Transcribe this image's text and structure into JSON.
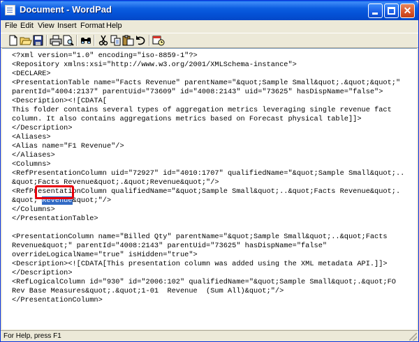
{
  "window": {
    "title": "Document - WordPad"
  },
  "menu": {
    "items": [
      "File",
      "Edit",
      "View",
      "Insert",
      "Format",
      "Help"
    ]
  },
  "toolbar": {
    "icons": [
      "new-icon",
      "open-icon",
      "save-icon",
      "print-icon",
      "print-preview-icon",
      "find-icon",
      "cut-icon",
      "copy-icon",
      "paste-icon",
      "undo-icon",
      "date-time-icon"
    ]
  },
  "document": {
    "lines": [
      "<?xml version=\"1.0\" encoding=\"iso-8859-1\"?>",
      "<Repository xmlns:xsi=\"http://www.w3.org/2001/XMLSchema-instance\">",
      "<DECLARE>",
      "<PresentationTable name=\"Facts Revenue\" parentName=\"&quot;Sample Small&quot;.&quot;&quot;\"",
      "parentId=\"4004:2137\" parentUid=\"73609\" id=\"4008:2143\" uid=\"73625\" hasDispName=\"false\">",
      "<Description><![CDATA[",
      "This folder contains several types of aggregation metrics leveraging single revenue fact",
      "column. It also contains aggregations metrics based on Forecast physical table]]>",
      "</Description>",
      "<Aliases>",
      "<Alias name=\"F1 Revenue\"/>",
      "</Aliases>",
      "<Columns>",
      "<RefPresentationColumn uid=\"72927\" id=\"4010:1707\" qualifiedName=\"&quot;Sample Small&quot;..",
      "&quot;Facts Revenue&quot;.&quot;Revenue&quot;\"/>",
      "<RefPresentationColumn qualifiedName=\"&quot;Sample Small&quot;..&quot;Facts Revenue&quot;.",
      "&quot; ",
      "</Columns>",
      "</PresentationTable>",
      "",
      "<PresentationColumn name=\"Billed Qty\" parentName=\"&quot;Sample Small&quot;..&quot;Facts",
      "Revenue&quot;\" parentId=\"4008:2143\" parentUid=\"73625\" hasDispName=\"false\"",
      "overrideLogicalName=\"true\" isHidden=\"true\">",
      "<Description><![CDATA[This presentation column was added using the XML metadata API.]]>",
      "</Description>",
      "<RefLogicalColumn id=\"930\" id=\"2006:102\" qualifiedName=\"&quot;Sample Small&quot;.&quot;FO",
      "Rev Base Measures&quot;.&quot;1-01  Revenue  (Sum All)&quot;\"/>",
      "</PresentationColumn>"
    ],
    "selected_word": "Revenue",
    "line_16_suffix": "&quot;\"/>"
  },
  "statusbar": {
    "text": "For Help, press F1"
  },
  "colors": {
    "titlebar": "#0b5de0",
    "selection": "#316ac5",
    "callout": "#e8000b"
  }
}
